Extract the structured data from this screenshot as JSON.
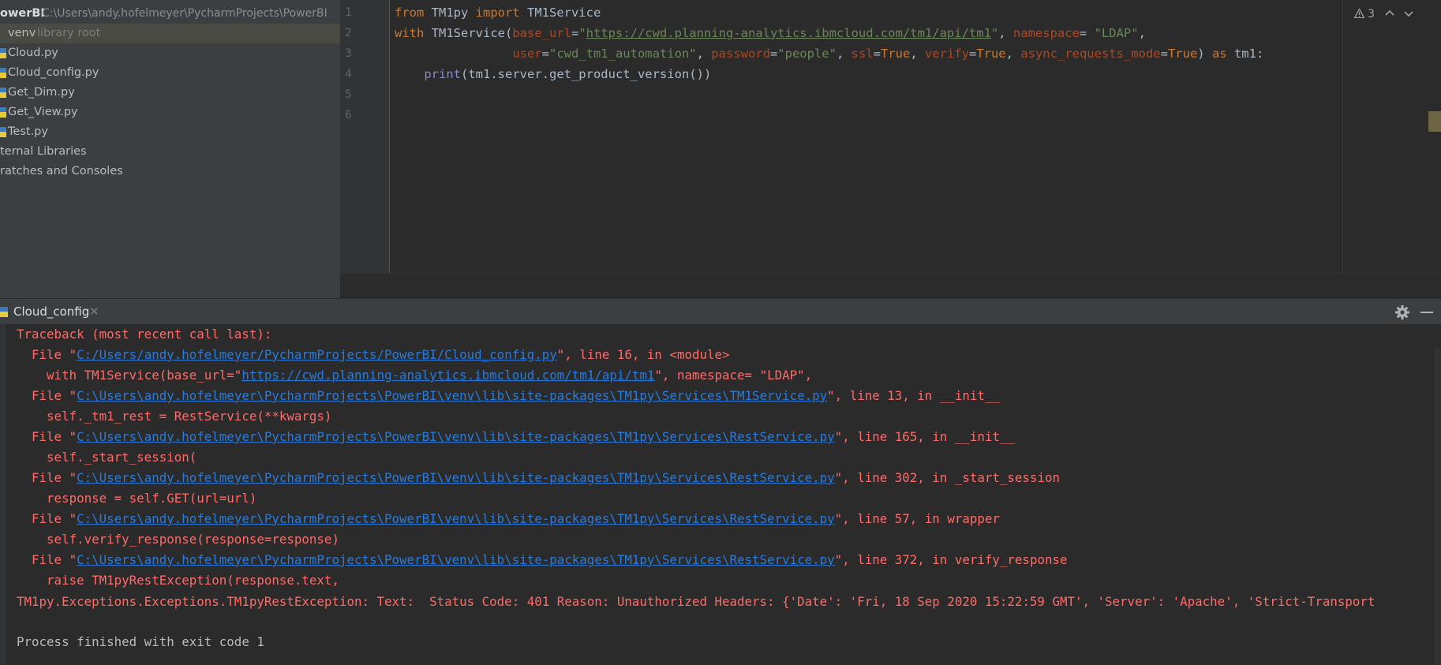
{
  "project": {
    "root_name": "owerBI",
    "root_path": "C:\\Users\\andy.hofelmeyer\\PycharmProjects\\PowerBI",
    "venv_name": "venv",
    "venv_note": "library root",
    "files": [
      "Cloud.py",
      "Cloud_config.py",
      "Get_Dim.py",
      "Get_View.py",
      "Test.py"
    ],
    "external_libraries": "ternal Libraries",
    "scratches": "ratches and Consoles"
  },
  "editor": {
    "line_numbers": [
      "1",
      "2",
      "3",
      "4",
      "5",
      "6"
    ],
    "inspection_count": "3",
    "line1": {
      "kw_from": "from",
      "module": " TM1py ",
      "kw_import": "import",
      "cls": " TM1Service"
    },
    "line2": {
      "kw_with": "with",
      "call": " TM1Service(",
      "p_base_url": "base_url",
      "eq1": "=",
      "q1": "\"",
      "url": "https://cwd.planning-analytics.ibmcloud.com/tm1/api/tm1",
      "q2": "\"",
      "comma1": ", ",
      "p_namespace": "namespace",
      "eq2": "=",
      "ns_value": " \"LDAP\"",
      "comma2": ","
    },
    "line3": {
      "indent": "                ",
      "p_user": "user",
      "eq": "=",
      "user_value": "\"cwd_tm1_automation\"",
      "c1": ", ",
      "p_password": "password",
      "eq2": "=",
      "password_value": "\"people\"",
      "c2": ", ",
      "p_ssl": "ssl",
      "eq3": "=",
      "ssl_value": "True",
      "c3": ", ",
      "p_verify": "verify",
      "eq4": "=",
      "verify_value": "True",
      "c4": ", ",
      "p_async": "async_requests_mode",
      "eq5": "=",
      "async_value": "True",
      "close": ") ",
      "kw_as": "as",
      "alias": " tm1:"
    },
    "line4": {
      "indent": "    ",
      "fn": "print",
      "rest": "(tm1.server.get_product_version())"
    }
  },
  "run": {
    "tab_label": "Cloud_config",
    "tab_close": "✕"
  },
  "console": {
    "traceback": "Traceback (most recent call last):",
    "frames": [
      {
        "prefix": "  File \"",
        "link": "C:/Users/andy.hofelmeyer/PycharmProjects/PowerBI/Cloud_config.py",
        "suffix": "\", line 16, in <module>"
      },
      {
        "prefix": "  File \"",
        "link": "C:\\Users\\andy.hofelmeyer\\PycharmProjects\\PowerBI\\venv\\lib\\site-packages\\TM1py\\Services\\TM1Service.py",
        "suffix": "\", line 13, in __init__"
      },
      {
        "prefix": "  File \"",
        "link": "C:\\Users\\andy.hofelmeyer\\PycharmProjects\\PowerBI\\venv\\lib\\site-packages\\TM1py\\Services\\RestService.py",
        "suffix": "\", line 165, in __init__"
      },
      {
        "prefix": "  File \"",
        "link": "C:\\Users\\andy.hofelmeyer\\PycharmProjects\\PowerBI\\venv\\lib\\site-packages\\TM1py\\Services\\RestService.py",
        "suffix": "\", line 302, in _start_session"
      },
      {
        "prefix": "  File \"",
        "link": "C:\\Users\\andy.hofelmeyer\\PycharmProjects\\PowerBI\\venv\\lib\\site-packages\\TM1py\\Services\\RestService.py",
        "suffix": "\", line 57, in wrapper"
      },
      {
        "prefix": "  File \"",
        "link": "C:\\Users\\andy.hofelmeyer\\PycharmProjects\\PowerBI\\venv\\lib\\site-packages\\TM1py\\Services\\RestService.py",
        "suffix": "\", line 372, in verify_response"
      }
    ],
    "code_1_prefix": "    with TM1Service(base_url=\"",
    "code_1_link": "https://cwd.planning-analytics.ibmcloud.com/tm1/api/tm1",
    "code_1_suffix": "\", namespace= \"LDAP\",",
    "code_2": "    self._tm1_rest = RestService(**kwargs)",
    "code_3": "    self._start_session(",
    "code_4": "    response = self.GET(url=url)",
    "code_5": "    self.verify_response(response=response)",
    "code_6": "    raise TM1pyRestException(response.text,",
    "exception": "TM1py.Exceptions.Exceptions.TM1pyRestException: Text:  Status Code: 401 Reason: Unauthorized Headers: {'Date': 'Fri, 18 Sep 2020 15:22:59 GMT', 'Server': 'Apache', 'Strict-Transport",
    "finished": "Process finished with exit code 1"
  },
  "colors": {
    "error_red": "#ff6b68",
    "link_blue": "#287bde",
    "keyword": "#cc7832",
    "string": "#6a8759",
    "param": "#aa4926"
  },
  "icons": [
    "python-file-icon",
    "warning-icon",
    "chevron-up-icon",
    "chevron-down-icon",
    "gear-icon",
    "minimize-icon",
    "close-icon"
  ]
}
